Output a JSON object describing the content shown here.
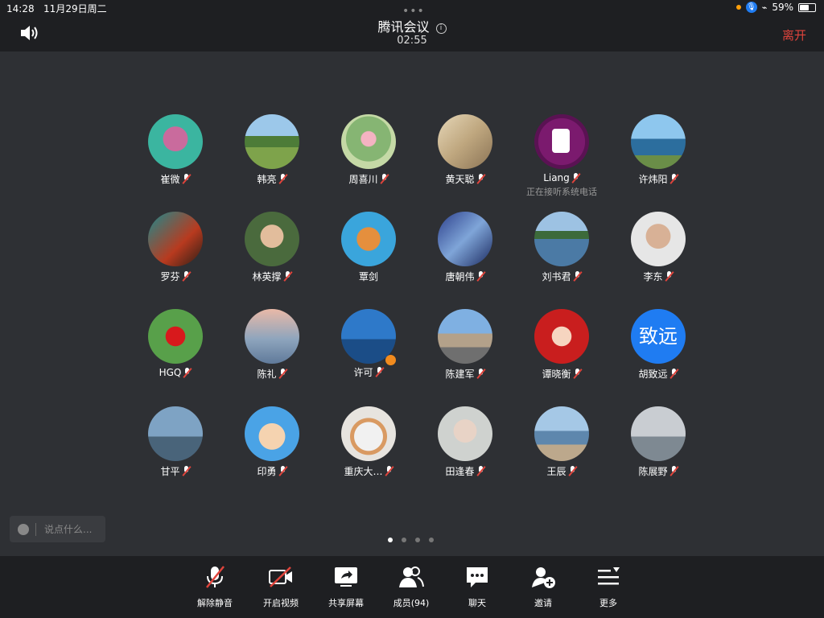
{
  "status_bar": {
    "time": "14:28",
    "date": "11月29日周二",
    "battery": "59%",
    "battery_level": 0.59
  },
  "header": {
    "title": "腾讯会议",
    "timer": "02:55",
    "leave_label": "离开"
  },
  "participants": [
    {
      "name": "崔微",
      "avatar": "pink-brain-on-teal",
      "muted": true
    },
    {
      "name": "韩亮",
      "avatar": "green-field-landscape",
      "muted": true
    },
    {
      "name": "周喜川",
      "avatar": "lotus-flower",
      "muted": true
    },
    {
      "name": "黄天聪",
      "avatar": "ink-painting",
      "muted": true
    },
    {
      "name": "Liang",
      "avatar": "phone-call-purple",
      "muted": true,
      "status": "正在接听系统电话"
    },
    {
      "name": "许炜阳",
      "avatar": "coastal-cliffs",
      "muted": true
    },
    {
      "name": "罗芬",
      "avatar": "fantasy-character",
      "muted": true
    },
    {
      "name": "林英撑",
      "avatar": "man-with-glasses",
      "muted": true
    },
    {
      "name": "覃剑",
      "avatar": "cartoon-pirate",
      "muted": false
    },
    {
      "name": "唐朝伟",
      "avatar": "blue-abstract",
      "muted": true
    },
    {
      "name": "刘书君",
      "avatar": "lake-landscape",
      "muted": true
    },
    {
      "name": "李东",
      "avatar": "baby-photo",
      "muted": true
    },
    {
      "name": "HGQ",
      "avatar": "red-hibiscus",
      "muted": true
    },
    {
      "name": "陈礼",
      "avatar": "misty-tree",
      "muted": true
    },
    {
      "name": "许可",
      "avatar": "sky-and-sea",
      "muted": true,
      "host": true
    },
    {
      "name": "陈建军",
      "avatar": "city-street",
      "muted": true
    },
    {
      "name": "谭晓衡",
      "avatar": "cartoon-girl-red",
      "muted": true
    },
    {
      "name": "胡致远",
      "avatar": "text",
      "avatar_text": "致远",
      "muted": true
    },
    {
      "name": "甘平",
      "avatar": "bridge-city",
      "muted": true
    },
    {
      "name": "印勇",
      "avatar": "cartoon-man-glasses",
      "muted": true
    },
    {
      "name": "重庆大…",
      "avatar": "white-cat",
      "muted": true
    },
    {
      "name": "田逢春",
      "avatar": "woman-portrait",
      "muted": true
    },
    {
      "name": "王辰",
      "avatar": "person-at-seaside",
      "muted": true
    },
    {
      "name": "陈展野",
      "avatar": "person-at-beach",
      "muted": true
    }
  ],
  "chat": {
    "placeholder": "说点什么..."
  },
  "pager": {
    "pages": 4,
    "current": 1
  },
  "toolbar": [
    {
      "label": "解除静音",
      "icon": "mic-muted-icon"
    },
    {
      "label": "开启视频",
      "icon": "video-off-icon"
    },
    {
      "label": "共享屏幕",
      "icon": "share-screen-icon"
    },
    {
      "label": "成员(94)",
      "icon": "members-icon"
    },
    {
      "label": "聊天",
      "icon": "chat-icon"
    },
    {
      "label": "邀请",
      "icon": "invite-icon"
    },
    {
      "label": "更多",
      "icon": "more-icon"
    }
  ],
  "colors": {
    "background": "#2e3034",
    "bar": "#1e1f22",
    "leave": "#e0443c",
    "mic_slash": "#e0443c",
    "accent_blue": "#1f7cf2"
  }
}
